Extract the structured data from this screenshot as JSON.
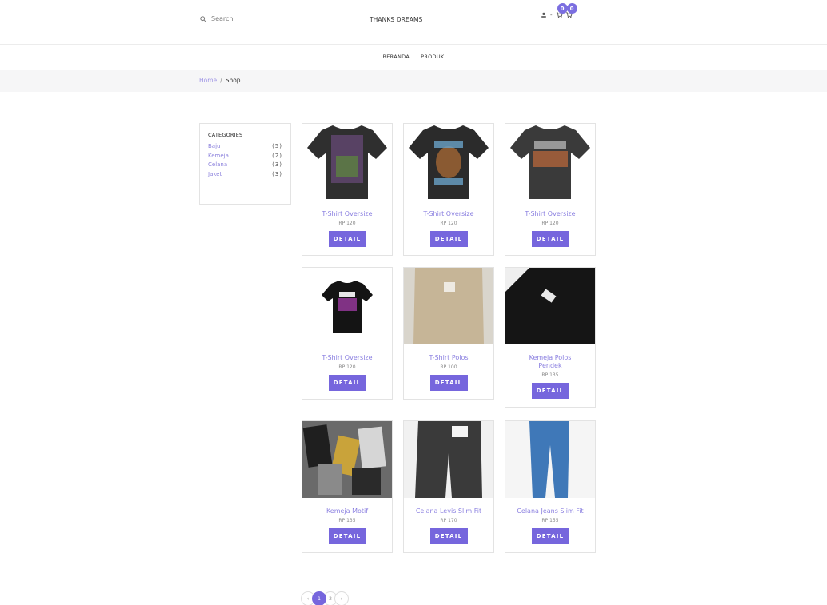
{
  "header": {
    "search_placeholder": "Search",
    "brand": "THANKS DREAMS",
    "wishlist_count": "0",
    "cart_count": "0",
    "dash": "-"
  },
  "nav": {
    "items": [
      "BERANDA",
      "PRODUK"
    ]
  },
  "breadcrumb": {
    "home": "Home",
    "separator": "/",
    "current": "Shop"
  },
  "categories": {
    "title": "CATEGORIES",
    "items": [
      {
        "name": "Baju",
        "count": "(5)"
      },
      {
        "name": "Kemeja",
        "count": "(2)"
      },
      {
        "name": "Celana",
        "count": "(3)"
      },
      {
        "name": "Jaket",
        "count": "(3)"
      }
    ]
  },
  "products": [
    {
      "title": "T-Shirt Oversize",
      "price": "RP 120",
      "button": "DETAIL"
    },
    {
      "title": "T-Shirt Oversize",
      "price": "RP 120",
      "button": "DETAIL"
    },
    {
      "title": "T-Shirt Oversize",
      "price": "RP 120",
      "button": "DETAIL"
    },
    {
      "title": "T-Shirt Oversize",
      "price": "RP 120",
      "button": "DETAIL"
    },
    {
      "title": "T-Shirt Polos",
      "price": "RP 100",
      "button": "DETAIL"
    },
    {
      "title": "Kemeja Polos Pendek",
      "price": "RP 135",
      "button": "DETAIL"
    },
    {
      "title": "Kemeja Motif",
      "price": "RP 135",
      "button": "DETAIL"
    },
    {
      "title": "Celana Levis Slim Fit",
      "price": "RP 170",
      "button": "DETAIL"
    },
    {
      "title": "Celana Jeans Slim Fit",
      "price": "RP 155",
      "button": "DETAIL"
    }
  ],
  "pagination": {
    "prev": "‹",
    "pages": [
      "1",
      "2"
    ],
    "next": "›"
  },
  "colors": {
    "accent": "#7666dd",
    "link": "#8a7fe0",
    "breadcrumb_bg": "#f6f6f7"
  }
}
